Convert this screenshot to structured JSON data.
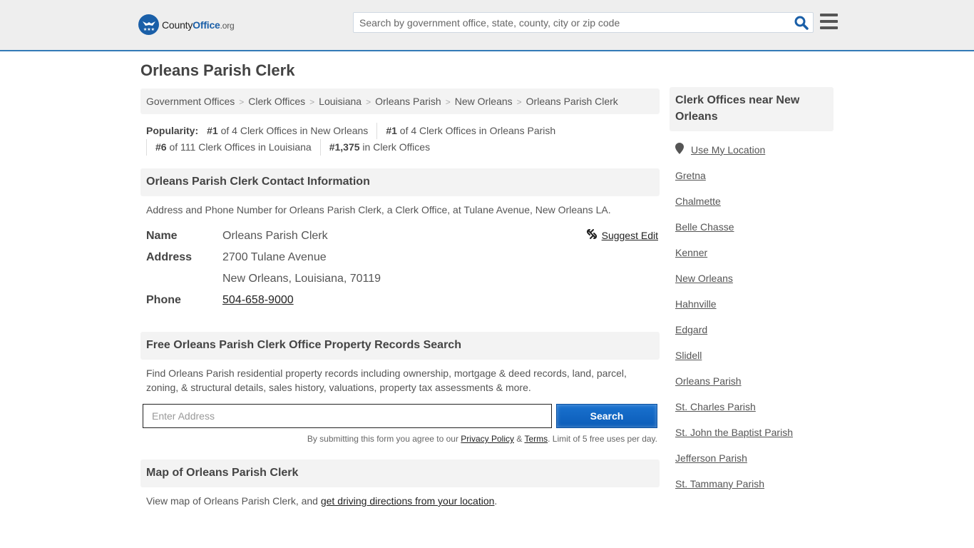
{
  "header": {
    "logo": {
      "name": "County",
      "office": "Office",
      "tld": ".org"
    },
    "search_placeholder": "Search by government office, state, county, city or zip code",
    "accent_color": "#337ab7"
  },
  "page_title": "Orleans Parish Clerk",
  "breadcrumb": [
    "Government Offices",
    "Clerk Offices",
    "Louisiana",
    "Orleans Parish",
    "New Orleans",
    "Orleans Parish Clerk"
  ],
  "breadcrumb_separator": ">",
  "popularity": {
    "label": "Popularity:",
    "items": [
      {
        "rank": "#1",
        "text": "of 4 Clerk Offices in New Orleans"
      },
      {
        "rank": "#1",
        "text": "of 4 Clerk Offices in Orleans Parish"
      },
      {
        "rank": "#6",
        "text": "of 111 Clerk Offices in Louisiana"
      },
      {
        "rank": "#1,375",
        "text": "in Clerk Offices"
      }
    ]
  },
  "contact": {
    "heading": "Orleans Parish Clerk Contact Information",
    "description": "Address and Phone Number for Orleans Parish Clerk, a Clerk Office, at Tulane Avenue, New Orleans LA.",
    "suggest_edit": "Suggest Edit",
    "name_label": "Name",
    "name": "Orleans Parish Clerk",
    "address_label": "Address",
    "address_line1": "2700 Tulane Avenue",
    "address_line2": "New Orleans, Louisiana, 70119",
    "phone_label": "Phone",
    "phone": "504-658-9000"
  },
  "property": {
    "heading": "Free Orleans Parish Clerk Office Property Records Search",
    "description": "Find Orleans Parish residential property records including ownership, mortgage & deed records, land, parcel, zoning, & structural details, sales history, valuations, property tax assessments & more.",
    "input_placeholder": "Enter Address",
    "search_label": "Search",
    "disclaimer_prefix": "By submitting this form you agree to our",
    "privacy_policy": "Privacy Policy",
    "amp": "&",
    "terms": "Terms",
    "disclaimer_suffix": ". Limit of 5 free uses per day."
  },
  "map": {
    "heading": "Map of Orleans Parish Clerk",
    "text_prefix": "View map of Orleans Parish Clerk, and",
    "link": "get driving directions from your location",
    "text_suffix": "."
  },
  "sidebar": {
    "heading": "Clerk Offices near New Orleans",
    "use_location": "Use My Location",
    "items": [
      "Gretna",
      "Chalmette",
      "Belle Chasse",
      "Kenner",
      "New Orleans",
      "Hahnville",
      "Edgard",
      "Slidell",
      "Orleans Parish",
      "St. Charles Parish",
      "St. John the Baptist Parish",
      "Jefferson Parish",
      "St. Tammany Parish"
    ]
  }
}
